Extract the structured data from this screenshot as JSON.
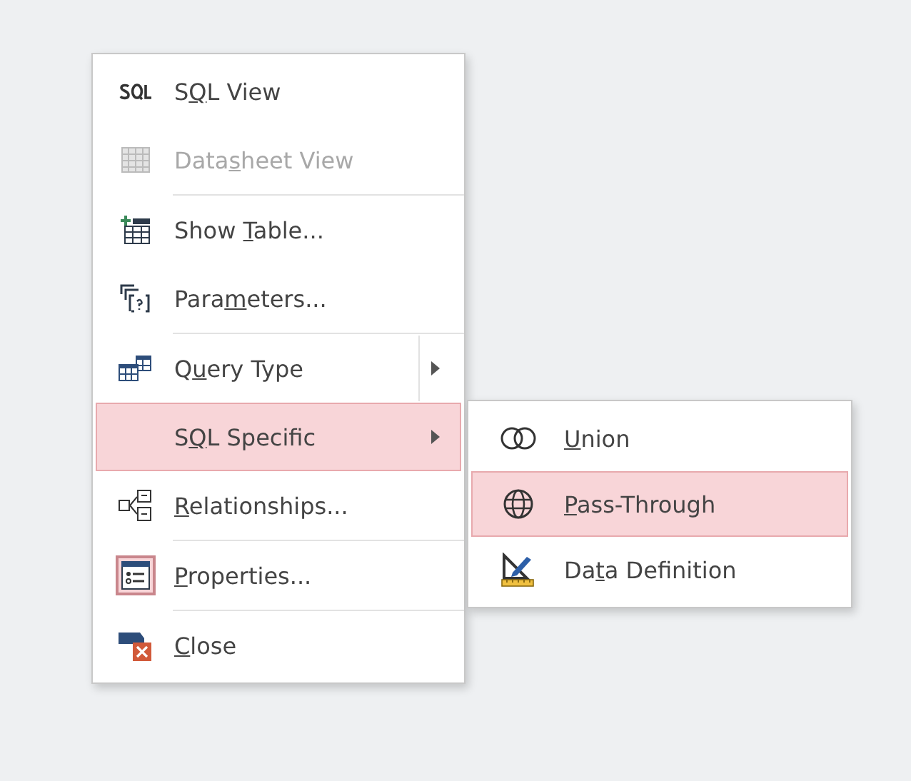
{
  "menu": {
    "items": [
      {
        "kind": "command",
        "pre": "S",
        "key": "Q",
        "post": "L View",
        "disabled": false,
        "selected": false,
        "checked": false,
        "separator_after": false
      },
      {
        "kind": "command",
        "pre": "Data",
        "key": "s",
        "post": "heet View",
        "disabled": true,
        "selected": false,
        "checked": false,
        "separator_after": true
      },
      {
        "kind": "command",
        "pre": "Show ",
        "key": "T",
        "post": "able...",
        "disabled": false,
        "selected": false,
        "checked": false,
        "separator_after": false
      },
      {
        "kind": "command",
        "pre": "Para",
        "key": "m",
        "post": "eters...",
        "disabled": false,
        "selected": false,
        "checked": false,
        "separator_after": true
      },
      {
        "kind": "split",
        "pre": "Q",
        "key": "u",
        "post": "ery Type",
        "disabled": false,
        "selected": false,
        "checked": false,
        "separator_after": false
      },
      {
        "kind": "submenu",
        "pre": "S",
        "key": "Q",
        "post": "L Specific",
        "disabled": false,
        "selected": true,
        "checked": false,
        "separator_after": false
      },
      {
        "kind": "command",
        "key": "R",
        "post": "elationships...",
        "disabled": false,
        "selected": false,
        "checked": false,
        "separator_after": true
      },
      {
        "kind": "command",
        "key": "P",
        "post": "roperties...",
        "disabled": false,
        "selected": false,
        "checked": true,
        "separator_after": true
      },
      {
        "kind": "command",
        "key": "C",
        "post": "lose",
        "disabled": false,
        "selected": false,
        "checked": false,
        "separator_after": false
      }
    ]
  },
  "submenu": {
    "items": [
      {
        "key": "U",
        "post": "nion",
        "selected": false
      },
      {
        "key": "P",
        "post": "ass-Through",
        "selected": true
      },
      {
        "pre": "Da",
        "key": "t",
        "post": "a Definition",
        "selected": false
      }
    ]
  }
}
